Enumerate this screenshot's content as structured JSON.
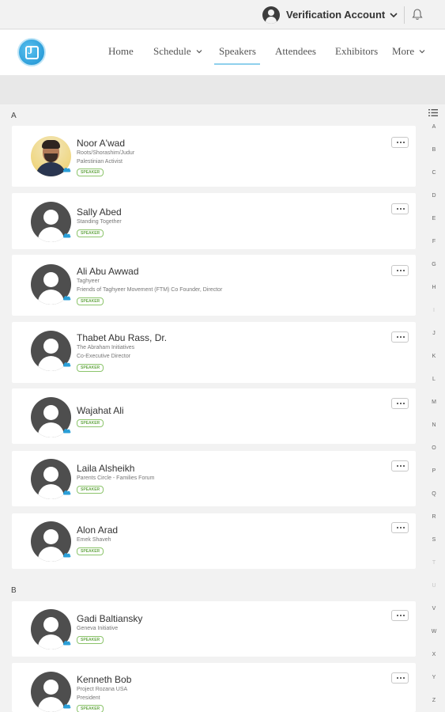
{
  "account": {
    "name": "Verification Account"
  },
  "nav": {
    "home": "Home",
    "schedule": "Schedule",
    "speakers": "Speakers",
    "attendees": "Attendees",
    "exhibitors": "Exhibitors",
    "more": "More"
  },
  "sections": [
    {
      "letter": "A"
    },
    {
      "letter": "B"
    }
  ],
  "az_index": [
    "A",
    "B",
    "C",
    "D",
    "E",
    "F",
    "G",
    "H",
    "I",
    "J",
    "K",
    "L",
    "M",
    "N",
    "O",
    "P",
    "Q",
    "R",
    "S",
    "T",
    "U",
    "V",
    "W",
    "X",
    "Y",
    "Z"
  ],
  "speakers": [
    {
      "name": "Noor A'wad",
      "org": "Roots/Shorashim/Judur",
      "title": "Palestinian Activist",
      "badge": "SPEAKER",
      "photo": true
    },
    {
      "name": "Sally Abed",
      "org": "Standing Together",
      "title": "",
      "badge": "SPEAKER"
    },
    {
      "name": "Ali Abu Awwad",
      "org": "Taghyeer",
      "title": "Friends of Taghyeer Movement (FTM) Co Founder, Director",
      "badge": "SPEAKER"
    },
    {
      "name": "Thabet Abu Rass, Dr.",
      "org": "The Abraham Initiatives",
      "title": "Co-Executive Director",
      "badge": "SPEAKER"
    },
    {
      "name": "Wajahat Ali",
      "org": "",
      "title": "",
      "badge": "SPEAKER"
    },
    {
      "name": "Laila Alsheikh",
      "org": "Parents Circle - Families Forum",
      "title": "",
      "badge": "SPEAKER"
    },
    {
      "name": "Alon Arad",
      "org": "Emek Shaveh",
      "title": "",
      "badge": "SPEAKER"
    },
    {
      "name": "Gadi Baltiansky",
      "org": "Geneva Initiative",
      "title": "",
      "badge": "SPEAKER"
    },
    {
      "name": "Kenneth Bob",
      "org": "Project Rozana USA",
      "title": "President",
      "badge": "SPEAKER"
    }
  ]
}
